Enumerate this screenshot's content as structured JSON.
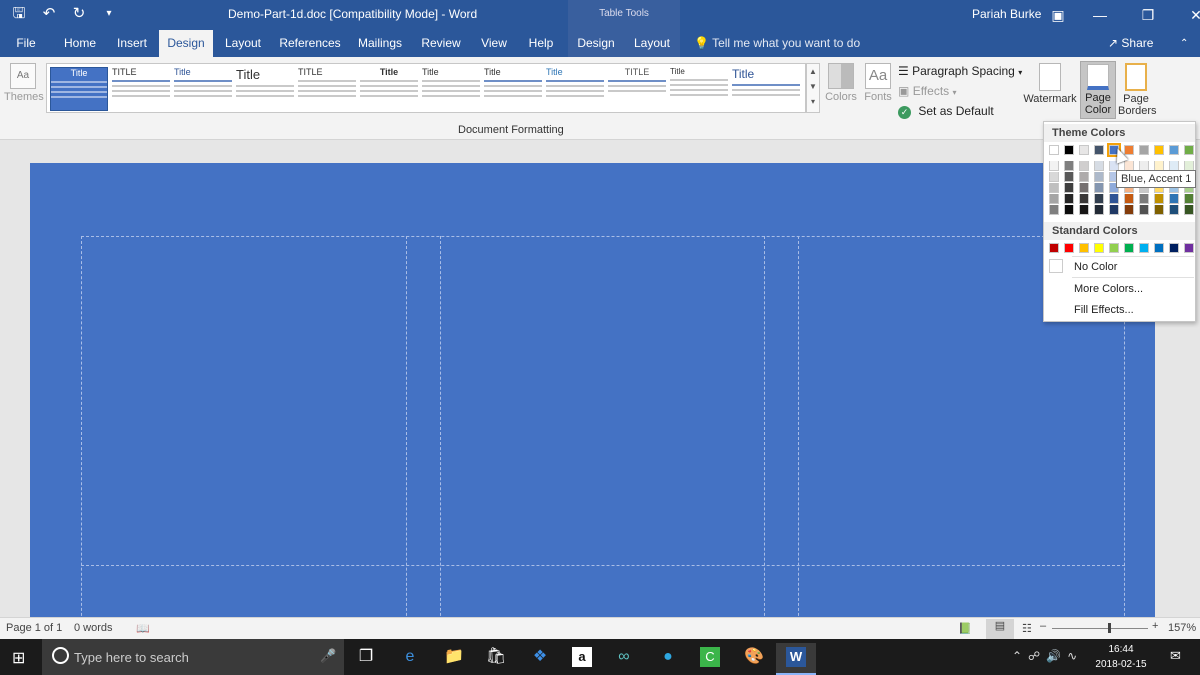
{
  "titlebar": {
    "doc_title": "Demo-Part-1d.doc [Compatibility Mode]  -  Word",
    "contextual_tab_group": "Table Tools",
    "user_name": "Pariah Burke",
    "qat": [
      "save-icon",
      "undo-icon",
      "redo-icon",
      "customize-qat-icon"
    ]
  },
  "tabs": [
    "File",
    "Home",
    "Insert",
    "Design",
    "Layout",
    "References",
    "Mailings",
    "Review",
    "View",
    "Help"
  ],
  "contextual_tabs": [
    "Design",
    "Layout"
  ],
  "tell_me": "Tell me what you want to do",
  "share": "Share",
  "ribbon": {
    "themes_label": "Themes",
    "style_thumbnails": [
      "Title",
      "TITLE",
      "Title",
      "Title",
      "TITLE",
      "Title",
      "Title",
      "Title",
      "Title",
      "TITLE",
      "Title",
      "Title"
    ],
    "group_label": "Document Formatting",
    "colors_label": "Colors",
    "fonts_label": "Fonts",
    "paragraph_spacing": "Paragraph Spacing",
    "effects": "Effects",
    "set_as_default": "Set as Default",
    "watermark": "Watermark",
    "page_color": "Page Color",
    "page_borders": "Page Borders"
  },
  "page_color_dropdown": {
    "theme_colors_header": "Theme Colors",
    "standard_colors_header": "Standard Colors",
    "no_color": "No Color",
    "more_colors": "More Colors...",
    "fill_effects": "Fill Effects...",
    "tooltip": "Blue, Accent 1",
    "theme_top_row": [
      "#ffffff",
      "#000000",
      "#e7e6e6",
      "#44546a",
      "#4472c4",
      "#ed7d31",
      "#a5a5a5",
      "#ffc000",
      "#5b9bd5",
      "#70ad47"
    ],
    "theme_shades": [
      [
        "#f2f2f2",
        "#7f7f7f",
        "#d0cece",
        "#d6dce4",
        "#d9e2f3",
        "#fbe5d5",
        "#ededed",
        "#fff2cc",
        "#deebf6",
        "#e2efd9"
      ],
      [
        "#d8d8d8",
        "#595959",
        "#aeabab",
        "#adb9ca",
        "#b4c6e7",
        "#f7cbac",
        "#dbdbdb",
        "#fee599",
        "#bdd7ee",
        "#c5e0b3"
      ],
      [
        "#bfbfbf",
        "#3f3f3f",
        "#757070",
        "#8496b0",
        "#8eaadb",
        "#f4b183",
        "#c9c9c9",
        "#ffd965",
        "#9cc3e5",
        "#a8d08d"
      ],
      [
        "#a5a5a5",
        "#262626",
        "#3a3838",
        "#323f4f",
        "#2f5496",
        "#c55a11",
        "#7b7b7b",
        "#bf9000",
        "#2e75b5",
        "#538135"
      ],
      [
        "#7f7f7f",
        "#0c0c0c",
        "#171616",
        "#222a35",
        "#1f3864",
        "#833c0b",
        "#525252",
        "#7f6000",
        "#1e4e79",
        "#375623"
      ]
    ],
    "standard_colors": [
      "#c00000",
      "#ff0000",
      "#ffc000",
      "#ffff00",
      "#92d050",
      "#00b050",
      "#00b0f0",
      "#0070c0",
      "#002060",
      "#7030a0"
    ],
    "highlighted_swatch": "Blue, Accent 1"
  },
  "statusbar": {
    "page": "Page 1 of 1",
    "words": "0 words",
    "zoom": "157%"
  },
  "taskbar": {
    "search_placeholder": "Type here to search",
    "time": "16:44",
    "date": "2018-02-15",
    "apps": [
      "task-view-icon",
      "edge-icon",
      "file-explorer-icon",
      "store-icon",
      "dropbox-icon",
      "amazon-icon",
      "infinity-icon",
      "skype-icon",
      "camtasia-icon",
      "paint-icon",
      "word-icon"
    ]
  },
  "colors": {
    "brand": "#2b579a",
    "page_fill": "#4472c4"
  }
}
